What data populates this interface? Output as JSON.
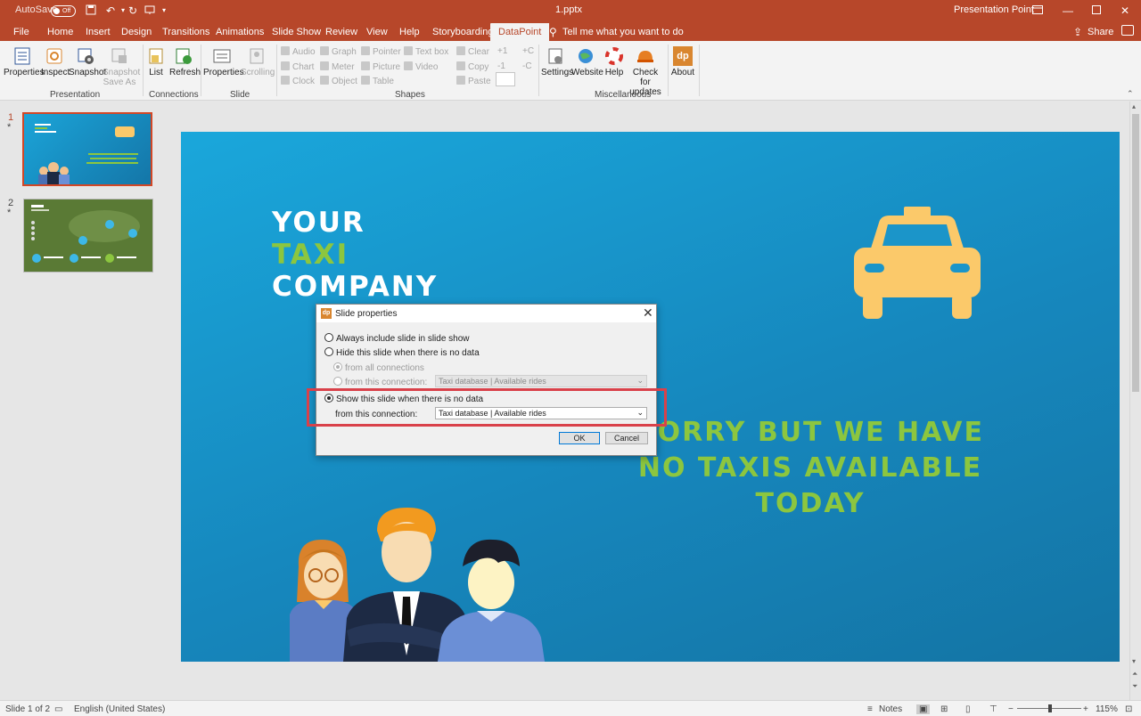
{
  "titlebar": {
    "autosave_label": "AutoSave",
    "autosave_state": "Off",
    "filename": "1.pptx",
    "app_name": "Presentation Point"
  },
  "tabs": [
    "File",
    "Home",
    "Insert",
    "Design",
    "Transitions",
    "Animations",
    "Slide Show",
    "Review",
    "View",
    "Help",
    "Storyboarding",
    "DataPoint"
  ],
  "tell_me": "Tell me what you want to do",
  "share": "Share",
  "ribbon": {
    "presentation": {
      "properties": "Properties",
      "inspect": "Inspect",
      "snapshot": "Snapshot",
      "snapshot_save_as": "Snapshot Save As",
      "label": "Presentation"
    },
    "connections": {
      "list": "List",
      "refresh": "Refresh",
      "label": "Connections"
    },
    "slide": {
      "properties": "Properties",
      "scrolling": "Scrolling",
      "label": "Slide"
    },
    "shapes": {
      "items": [
        "Audio",
        "Graph",
        "Pointer",
        "Text box",
        "Chart",
        "Meter",
        "Picture",
        "Video",
        "Clock",
        "Object",
        "Table"
      ],
      "edit": [
        "Clear",
        "Copy",
        "Paste"
      ],
      "num": [
        "+1",
        "-1",
        "+C",
        "-C"
      ],
      "label": "Shapes"
    },
    "misc": {
      "settings": "Settings",
      "website": "Website",
      "help": "Help",
      "check_updates": "Check for updates",
      "about": "About",
      "label": "Miscellaneous",
      "dp_logo": "dp"
    }
  },
  "thumbs": [
    {
      "number": "1",
      "star": "*"
    },
    {
      "number": "2",
      "star": "*"
    }
  ],
  "slide": {
    "line1": "YOUR",
    "line2": "TAXI",
    "line3": "COMPANY",
    "message": "SORRY BUT WE HAVE NO TAXIS AVAILABLE TODAY"
  },
  "dialog": {
    "title": "Slide properties",
    "logo": "dp",
    "opt_always": "Always include slide in slide show",
    "opt_hide": "Hide this slide when there is no data",
    "sub_all": "from all connections",
    "sub_this": "from this connection:",
    "hide_combo": "Taxi database | Available rides",
    "opt_show": "Show this slide when there is no data",
    "show_from": "from this connection:",
    "show_combo": "Taxi database | Available rides",
    "ok": "OK",
    "cancel": "Cancel"
  },
  "statusbar": {
    "slide_info": "Slide 1 of 2",
    "language": "English (United States)",
    "notes": "Notes",
    "zoom": "115%"
  },
  "colors": {
    "accent": "#b7472a",
    "slide_blue": "#1aa7db",
    "green": "#8cc63f",
    "taxi_yellow": "#fbc96a",
    "highlight_red": "#d9414a"
  }
}
